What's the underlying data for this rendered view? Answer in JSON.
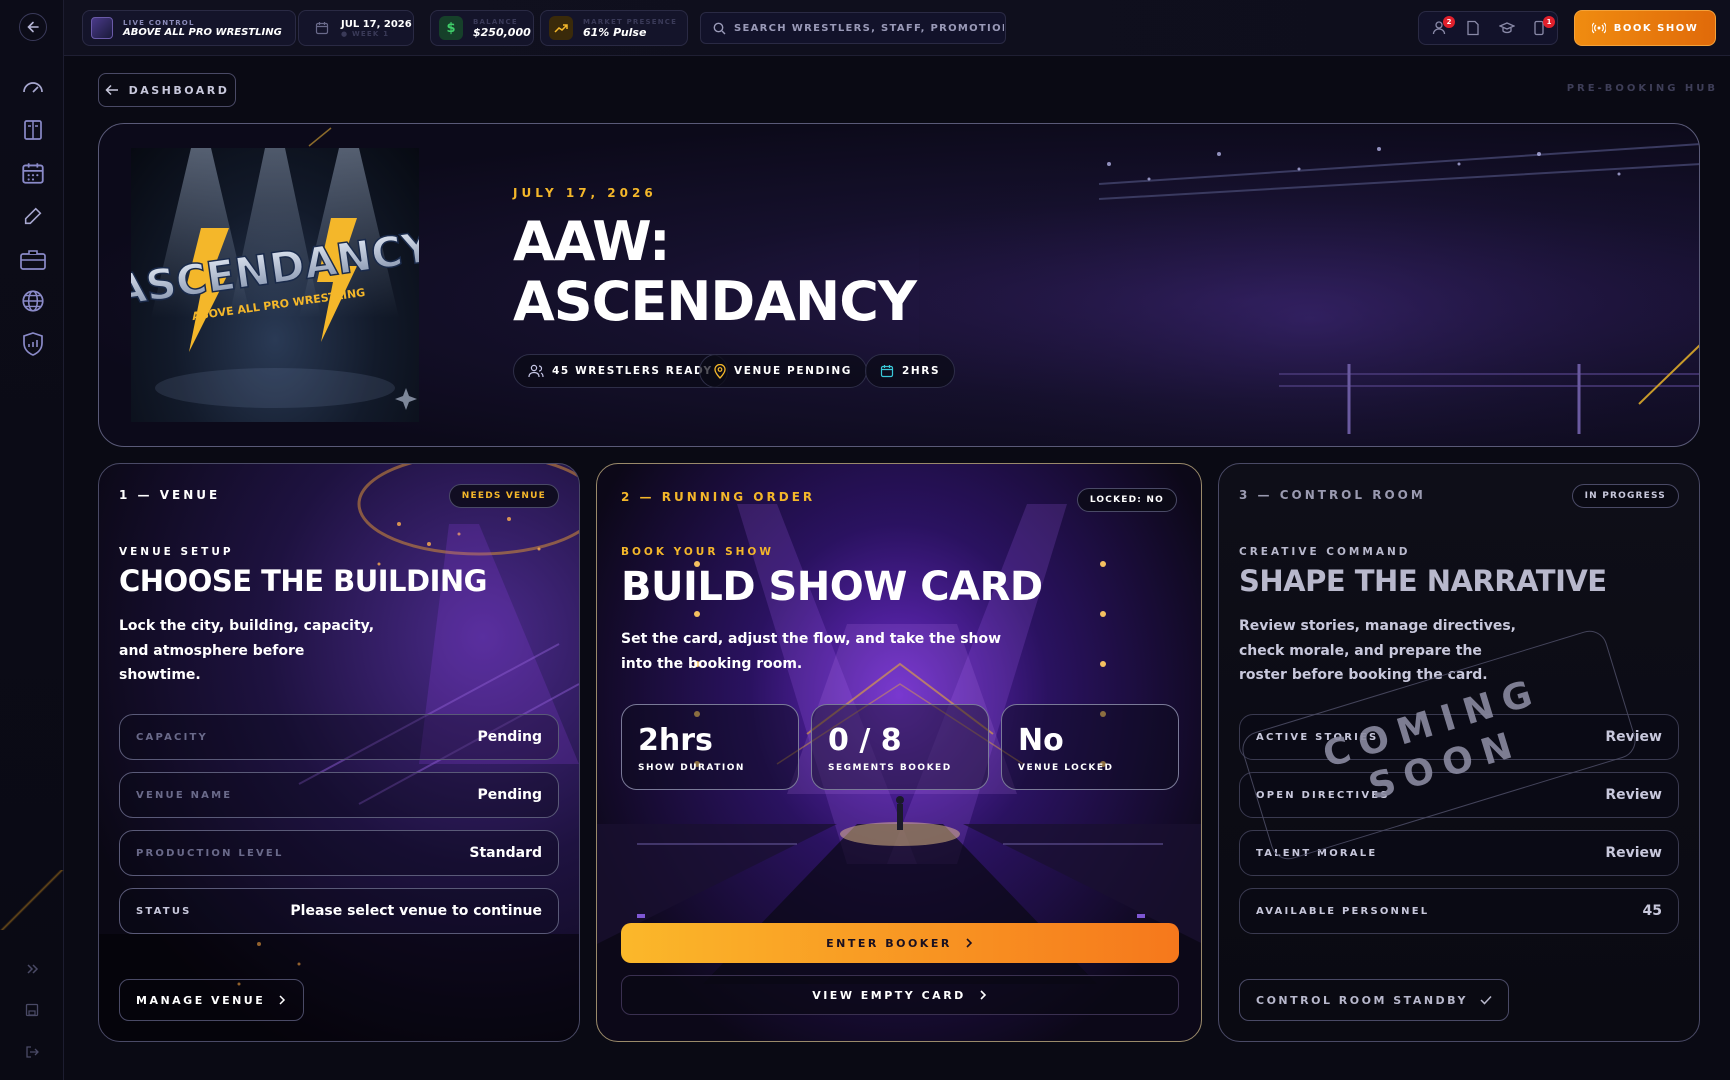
{
  "topbar": {
    "live_control_label": "LIVE CONTROL",
    "promotion_name": "ABOVE ALL PRO WRESTLING",
    "date": "JUL 17, 2026",
    "week": "WEEK 1",
    "balance_label": "BALANCE",
    "balance_value": "$250,000",
    "market_label": "MARKET PRESENCE",
    "market_value": "61% Pulse",
    "search_placeholder": "SEARCH WRESTLERS, STAFF, PROMOTIONS...",
    "badge_roster": "2",
    "badge_phone": "1",
    "book_show_label": "BOOK SHOW"
  },
  "nav": {
    "dashboard_label": "DASHBOARD",
    "hub_label": "PRE-BOOKING HUB"
  },
  "hero": {
    "date": "JULY 17, 2026",
    "title_line1": "AAW:",
    "title_line2": "ASCENDANCY",
    "logo_text": "ASCENDANCY",
    "logo_subtext": "ABOVE ALL PRO WRESTLING",
    "chips": [
      "45 WRESTLERS READY",
      "VENUE PENDING",
      "2HRS"
    ]
  },
  "venue_card": {
    "step": "1 — VENUE",
    "tag": "NEEDS VENUE",
    "kicker": "VENUE SETUP",
    "title": "CHOOSE THE BUILDING",
    "desc_lines": [
      "Lock the city, building, capacity,",
      "and atmosphere before",
      "showtime."
    ],
    "rows": [
      {
        "label": "CAPACITY",
        "value": "Pending"
      },
      {
        "label": "VENUE NAME",
        "value": "Pending"
      },
      {
        "label": "PRODUCTION LEVEL",
        "value": "Standard"
      },
      {
        "label": "STATUS",
        "value": "Please select venue to continue"
      }
    ],
    "button": "MANAGE VENUE"
  },
  "order_card": {
    "step": "2 — RUNNING ORDER",
    "tag": "LOCKED: NO",
    "kicker": "BOOK YOUR SHOW",
    "title": "BUILD SHOW CARD",
    "desc_lines": [
      "Set the card, adjust the flow, and take the show",
      "into the booking room."
    ],
    "stats": [
      {
        "value": "2hrs",
        "label": "SHOW DURATION"
      },
      {
        "value": "0 / 8",
        "label": "SEGMENTS BOOKED"
      },
      {
        "value": "No",
        "label": "VENUE LOCKED"
      }
    ],
    "primary_button": "ENTER BOOKER",
    "secondary_button": "VIEW EMPTY CARD"
  },
  "control_card": {
    "step": "3 — CONTROL ROOM",
    "tag": "IN PROGRESS",
    "kicker": "CREATIVE COMMAND",
    "title": "SHAPE THE NARRATIVE",
    "desc_lines": [
      "Review stories, manage directives,",
      "check morale, and prepare the",
      "roster before booking the card."
    ],
    "rows": [
      {
        "label": "ACTIVE STORIES",
        "value": "Review"
      },
      {
        "label": "OPEN DIRECTIVES",
        "value": "Review"
      },
      {
        "label": "TALENT MORALE",
        "value": "Review"
      },
      {
        "label": "AVAILABLE PERSONNEL",
        "value": "45"
      }
    ],
    "stamp_line1": "COMING",
    "stamp_line2": "SOON",
    "button": "CONTROL ROOM STANDBY"
  },
  "colors": {
    "accent_gold": "#f4b72a",
    "accent_orange": "#f08c10",
    "badge_red": "#e0202c",
    "balance_green": "#2fa84f"
  }
}
